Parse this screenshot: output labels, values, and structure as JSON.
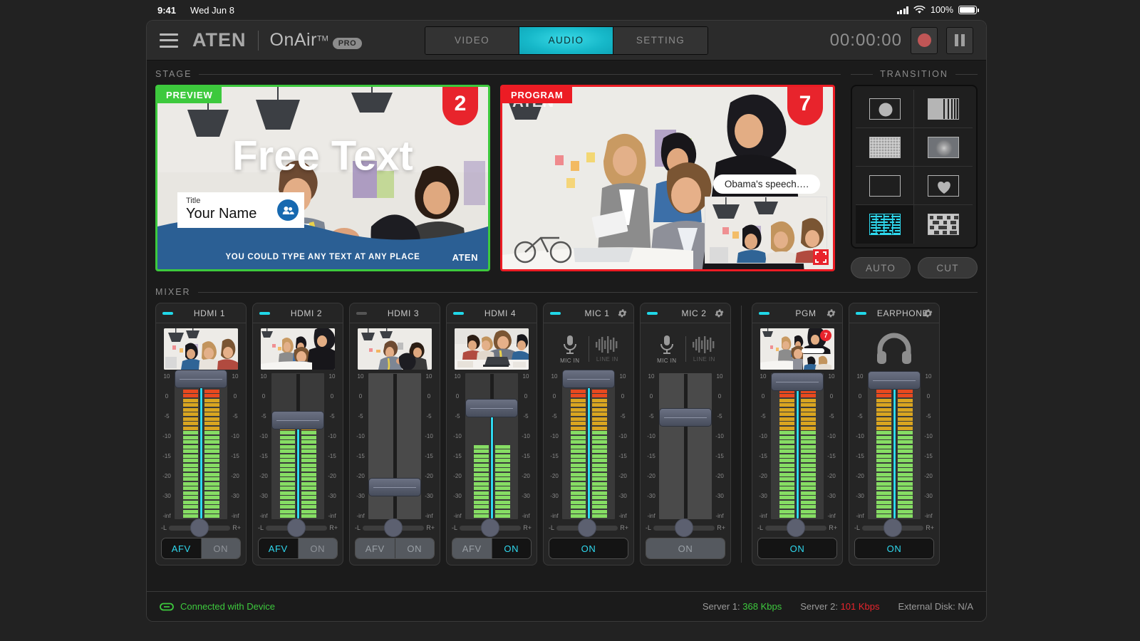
{
  "statusbar": {
    "time": "9:41",
    "date": "Wed Jun 8",
    "battery_pct": "100%"
  },
  "header": {
    "logo": "ATEN",
    "product": "OnAir",
    "tm": "TM",
    "pro_badge": "PRO",
    "tabs": [
      {
        "label": "VIDEO",
        "active": false
      },
      {
        "label": "AUDIO",
        "active": true
      },
      {
        "label": "SETTING",
        "active": false
      }
    ],
    "timer": "00:00:00",
    "record_label": "record-button",
    "pause_label": "pause-button"
  },
  "stage": {
    "title": "STAGE",
    "preview": {
      "tag": "PREVIEW",
      "source_number": "2",
      "free_text": "Free Text",
      "lower_third_title": "Title",
      "lower_third_name": "Your Name",
      "bottom_text": "YOU COULD TYPE ANY TEXT AT ANY PLACE",
      "bottom_logo": "ATEN"
    },
    "program": {
      "tag": "PROGRAM",
      "source_number": "7",
      "callout": "Obama's speech….",
      "watermark": "ATEN"
    }
  },
  "transition": {
    "title": "TRANSITION",
    "items": [
      {
        "name": "circle-wipe",
        "selected": false
      },
      {
        "name": "bars-wipe",
        "selected": false
      },
      {
        "name": "dots-dissolve",
        "selected": false
      },
      {
        "name": "soft-circle-blur",
        "selected": false
      },
      {
        "name": "plain-fade",
        "selected": false
      },
      {
        "name": "heart-wipe",
        "selected": false
      },
      {
        "name": "glitch-a",
        "selected": true
      },
      {
        "name": "mosaic-b",
        "selected": false
      }
    ],
    "auto_label": "AUTO",
    "cut_label": "CUT"
  },
  "mixer": {
    "title": "MIXER",
    "scale_labels": [
      "10",
      "0",
      "-5",
      "-10",
      "-15",
      "-20",
      "-30",
      "-inf"
    ],
    "pan_left": "-L",
    "pan_right": "R+",
    "channels": [
      {
        "name": "HDMI 1",
        "led": true,
        "gear": false,
        "type": "hdmi",
        "thumb": "meeting-group-clap",
        "fader_pct": 96,
        "level_pct": 100,
        "meter_active": true,
        "buttons": [
          {
            "label": "AFV",
            "state": "on"
          },
          {
            "label": "ON",
            "state": "off"
          }
        ]
      },
      {
        "name": "HDMI 2",
        "led": true,
        "gear": false,
        "type": "hdmi",
        "thumb": "office-discussion",
        "fader_pct": 68,
        "level_pct": 72,
        "meter_active": true,
        "buttons": [
          {
            "label": "AFV",
            "state": "on"
          },
          {
            "label": "ON",
            "state": "off"
          }
        ]
      },
      {
        "name": "HDMI 3",
        "led": false,
        "gear": false,
        "type": "hdmi",
        "thumb": "handshake-celebration",
        "fader_pct": 22,
        "level_pct": 0,
        "meter_active": false,
        "buttons": [
          {
            "label": "AFV",
            "state": "neutral"
          },
          {
            "label": "ON",
            "state": "neutral"
          }
        ]
      },
      {
        "name": "HDMI 4",
        "led": true,
        "gear": false,
        "type": "hdmi",
        "thumb": "team-laptop-table",
        "fader_pct": 76,
        "level_pct": 56,
        "meter_active": true,
        "buttons": [
          {
            "label": "AFV",
            "state": "neutral"
          },
          {
            "label": "ON",
            "state": "on"
          }
        ]
      },
      {
        "name": "MIC 1",
        "led": true,
        "gear": true,
        "type": "mic",
        "mic_in_label": "MIC IN",
        "line_in_label": "LINE IN",
        "input_selected": "MIC IN",
        "fader_pct": 96,
        "level_pct": 100,
        "meter_active": true,
        "buttons": [
          {
            "label": "ON",
            "state": "on"
          }
        ]
      },
      {
        "name": "MIC 2",
        "led": true,
        "gear": true,
        "type": "mic",
        "mic_in_label": "MIC IN",
        "line_in_label": "LINE IN",
        "input_selected": "MIC IN",
        "fader_pct": 70,
        "level_pct": 0,
        "meter_active": false,
        "buttons": [
          {
            "label": "ON",
            "state": "off"
          }
        ]
      },
      {
        "name": "PGM",
        "led": true,
        "gear": true,
        "type": "pgm",
        "thumb": "program-output",
        "badge": "7",
        "fader_pct": 94,
        "level_pct": 100,
        "meter_active": true,
        "buttons": [
          {
            "label": "ON",
            "state": "on"
          }
        ]
      },
      {
        "name": "EARPHONE",
        "led": true,
        "gear": true,
        "type": "earphone",
        "fader_pct": 95,
        "level_pct": 100,
        "meter_active": true,
        "buttons": [
          {
            "label": "ON",
            "state": "on"
          }
        ]
      }
    ]
  },
  "footer": {
    "connection": "Connected with Device",
    "server1_label": "Server 1:",
    "server1_value": "368 Kbps",
    "server2_label": "Server 2:",
    "server2_value": "101 Kbps",
    "disk": "External Disk: N/A"
  },
  "colors": {
    "accent_cyan": "#2fd9ef",
    "preview_green": "#3dc93d",
    "program_red": "#ec1c24",
    "badge_red": "#e8242c"
  }
}
